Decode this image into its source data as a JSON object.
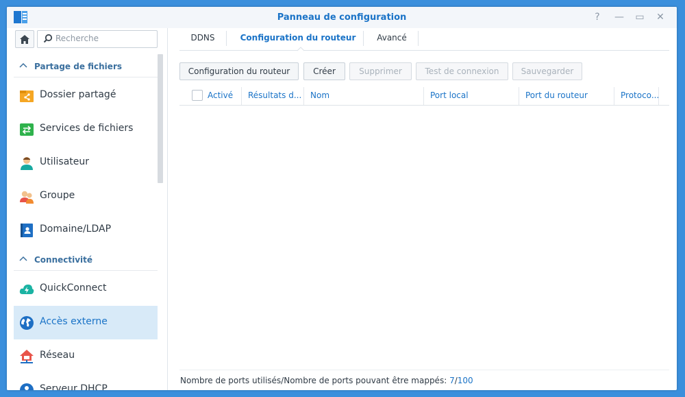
{
  "window": {
    "title": "Panneau de configuration",
    "controls": {
      "help": "?",
      "minimize": "—",
      "maximize": "▭",
      "close": "✕"
    }
  },
  "sidebar": {
    "search": {
      "placeholder": "Recherche"
    },
    "sections": [
      {
        "label": "Partage de fichiers"
      },
      {
        "label": "Connectivité"
      }
    ],
    "items": [
      {
        "label": "Dossier partagé",
        "icon": "shared-folder-icon"
      },
      {
        "label": "Services de fichiers",
        "icon": "file-services-icon"
      },
      {
        "label": "Utilisateur",
        "icon": "user-icon"
      },
      {
        "label": "Groupe",
        "icon": "group-icon"
      },
      {
        "label": "Domaine/LDAP",
        "icon": "domain-ldap-icon"
      },
      {
        "label": "QuickConnect",
        "icon": "quickconnect-icon"
      },
      {
        "label": "Accès externe",
        "icon": "external-access-icon",
        "active": true
      },
      {
        "label": "Réseau",
        "icon": "network-icon"
      },
      {
        "label": "Serveur DHCP",
        "icon": "dhcp-server-icon"
      }
    ]
  },
  "tabs": [
    {
      "label": "DDNS"
    },
    {
      "label": "Configuration du routeur",
      "active": true
    },
    {
      "label": "Avancé"
    }
  ],
  "toolbar": {
    "router_config": "Configuration du routeur",
    "create": "Créer",
    "delete": "Supprimer",
    "test_connection": "Test de connexion",
    "save": "Sauvegarder"
  },
  "table": {
    "columns": [
      "Activé",
      "Résultats d...",
      "Nom",
      "Port local",
      "Port du routeur",
      "Protoco..."
    ],
    "rows": []
  },
  "footer": {
    "label": "Nombre de ports utilisés/Nombre de ports pouvant être mappés: ",
    "used": "7",
    "separator": "/",
    "max": "100"
  },
  "colors": {
    "accent": "#1a73c7",
    "active_item_bg": "#d8eaf8",
    "desktop_bg": "#3b8fdc"
  }
}
